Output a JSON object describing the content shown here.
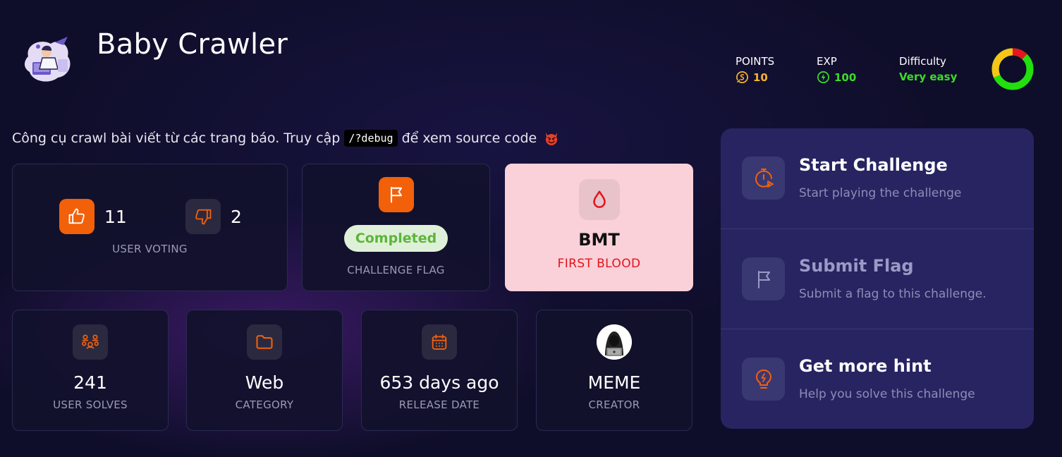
{
  "challenge": {
    "title": "Baby Crawler",
    "description_before": "Công cụ crawl bài viết từ các trang báo. Truy cập",
    "description_code": "/?debug",
    "description_after": "để xem source code"
  },
  "stats": {
    "points_label": "POINTS",
    "points_value": "10",
    "exp_label": "EXP",
    "exp_value": "100",
    "difficulty_label": "Difficulty",
    "difficulty_value": "Very easy"
  },
  "voting": {
    "up_count": "11",
    "down_count": "2",
    "caption": "USER VOTING"
  },
  "flag": {
    "status": "Completed",
    "caption": "CHALLENGE FLAG"
  },
  "first_blood": {
    "name": "BMT",
    "caption": "FIRST BLOOD"
  },
  "info": {
    "solves_value": "241",
    "solves_caption": "USER SOLVES",
    "category_value": "Web",
    "category_caption": "CATEGORY",
    "release_value": "653 days ago",
    "release_caption": "RELEASE DATE",
    "creator_value": "MEME",
    "creator_caption": "CREATOR"
  },
  "actions": [
    {
      "title": "Start Challenge",
      "subtitle": "Start playing the challenge",
      "icon": "timer-play-icon"
    },
    {
      "title": "Submit Flag",
      "subtitle": "Submit a flag to this challenge.",
      "icon": "flag-icon"
    },
    {
      "title": "Get more hint",
      "subtitle": "Help you solve this challenge",
      "icon": "lightbulb-icon"
    }
  ],
  "colors": {
    "accent": "#f2600a",
    "success": "#3ddc28",
    "gold": "#f5b52a",
    "panel": "#272461",
    "first_blood_bg": "#fad1d8"
  }
}
